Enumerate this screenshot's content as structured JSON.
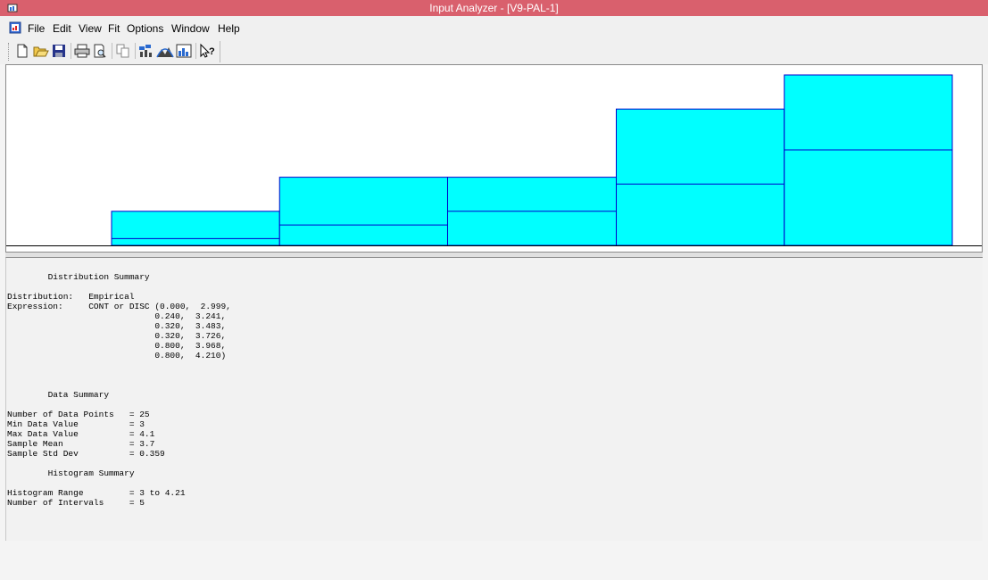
{
  "window": {
    "title": "Input Analyzer - [V9-PAL-1]",
    "app_icon": "input-analyzer-app-icon"
  },
  "menubar": {
    "doc_icon": "document-window-icon",
    "items": [
      "File",
      "Edit",
      "View",
      "Fit",
      "Options",
      "Window",
      "Help"
    ]
  },
  "toolbar": {
    "buttons": [
      {
        "name": "new-icon"
      },
      {
        "name": "open-folder-icon"
      },
      {
        "name": "save-disk-icon"
      },
      {
        "name": "print-icon"
      },
      {
        "name": "print-preview-icon"
      },
      {
        "name": "copy-icon"
      },
      {
        "name": "fit-data-icon"
      },
      {
        "name": "fit-distribution-icon"
      },
      {
        "name": "histogram-icon"
      },
      {
        "name": "context-help-icon"
      }
    ]
  },
  "chart_data": {
    "type": "bar",
    "bin_edges": [
      2.999,
      3.241,
      3.483,
      3.726,
      3.968,
      4.21
    ],
    "bin_counts": [
      1,
      2,
      2,
      4,
      5
    ],
    "cumulative_probability": [
      0.04,
      0.12,
      0.2,
      0.36,
      0.56
    ],
    "ylim": [
      0,
      5
    ],
    "grid": false,
    "colors": {
      "fill": "#00ffff",
      "stroke": "#0000cc",
      "axis": "#000000"
    }
  },
  "summary": {
    "lines": [
      "        Distribution Summary",
      "",
      "Distribution:   Empirical",
      "Expression:     CONT or DISC (0.000,  2.999,",
      "                             0.240,  3.241,",
      "                             0.320,  3.483,",
      "                             0.320,  3.726,",
      "                             0.800,  3.968,",
      "                             0.800,  4.210)",
      "",
      "",
      "",
      "        Data Summary",
      "",
      "Number of Data Points   = 25",
      "Min Data Value          = 3",
      "Max Data Value          = 4.1",
      "Sample Mean             = 3.7",
      "Sample Std Dev          = 0.359",
      "",
      "        Histogram Summary",
      "",
      "Histogram Range         = 3 to 4.21",
      "Number of Intervals     = 5"
    ]
  }
}
